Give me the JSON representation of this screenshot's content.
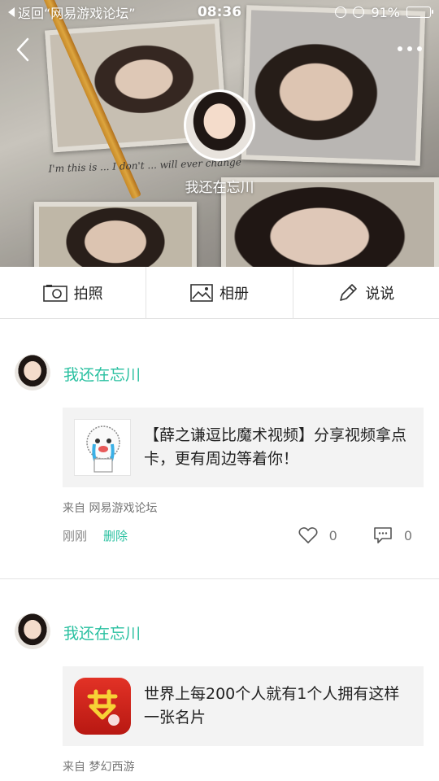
{
  "status_bar": {
    "back_label": "返回“网易游戏论坛”",
    "time": "08:36",
    "battery_percent": "91%",
    "battery_level": 0.91
  },
  "cover": {
    "handwriting": "I'm this is ... I don't ... will ever change"
  },
  "profile": {
    "name": "我还在忘川"
  },
  "actions": [
    {
      "label": "拍照",
      "icon": "camera-icon"
    },
    {
      "label": "相册",
      "icon": "image-icon"
    },
    {
      "label": "说说",
      "icon": "pencil-icon"
    }
  ],
  "posts": [
    {
      "author": "我还在忘川",
      "share_text": "【薛之谦逗比魔术视频】分享视频拿点卡，更有周边等着你！",
      "source": "来自 网易游戏论坛",
      "time": "刚刚",
      "delete_label": "删除",
      "likes": "0",
      "comments": "0"
    },
    {
      "author": "我还在忘川",
      "share_text": "世界上每200个人就有1个人拥有这样一张名片",
      "source": "来自 梦幻西游"
    }
  ],
  "colors": {
    "accent": "#29c0a0",
    "card_bg": "#f3f3f3",
    "divider": "#e3e3e3"
  }
}
